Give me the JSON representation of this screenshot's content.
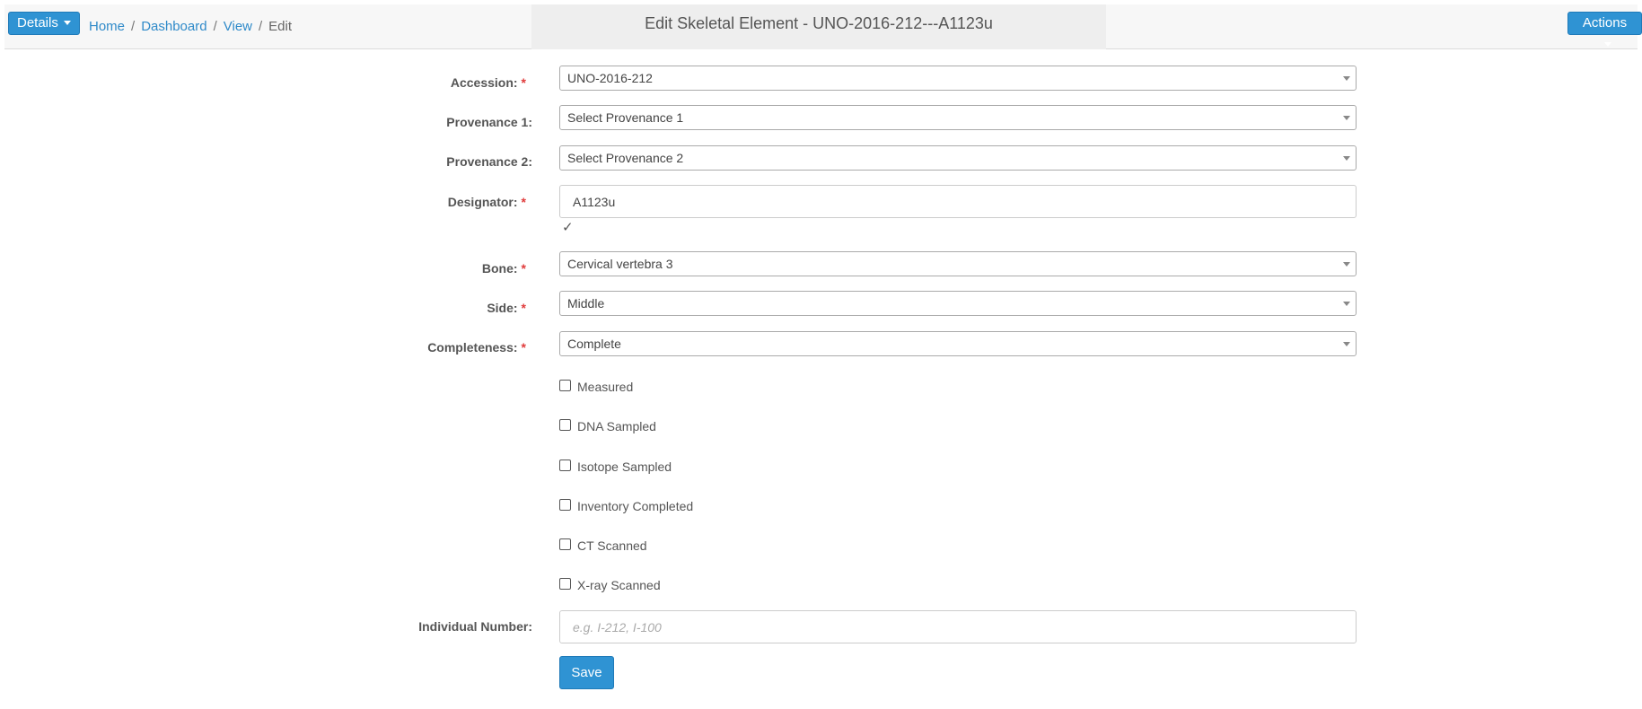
{
  "header": {
    "details_label": "Details",
    "actions_label": "Actions",
    "title": "Edit Skeletal Element - UNO-2016-212---A1123u",
    "breadcrumb": [
      "Home",
      "Dashboard",
      "View",
      "Edit"
    ],
    "breadcrumb_separator": "/"
  },
  "form": {
    "accession": {
      "label": "Accession:",
      "value": "UNO-2016-212",
      "required": true
    },
    "provenance1": {
      "label": "Provenance 1:",
      "value": "Select Provenance 1"
    },
    "provenance2": {
      "label": "Provenance 2:",
      "value": "Select Provenance 2"
    },
    "designator": {
      "label": "Designator:",
      "value": "A1123u",
      "required": true,
      "valid_mark": "✓"
    },
    "bone": {
      "label": "Bone:",
      "value": "Cervical vertebra 3",
      "required": true
    },
    "side": {
      "label": "Side:",
      "value": "Middle",
      "required": true
    },
    "completeness": {
      "label": "Completeness:",
      "value": "Complete",
      "required": true
    },
    "required_marker": "*",
    "checkboxes": [
      {
        "label": "Measured",
        "checked": false
      },
      {
        "label": "DNA Sampled",
        "checked": false
      },
      {
        "label": "Isotope Sampled",
        "checked": false
      },
      {
        "label": "Inventory Completed",
        "checked": false
      },
      {
        "label": "CT Scanned",
        "checked": false
      },
      {
        "label": "X-ray Scanned",
        "checked": false
      }
    ],
    "individual_number": {
      "label": "Individual Number:",
      "value": "",
      "placeholder": "e.g. I-212, I-100"
    },
    "save_label": "Save"
  },
  "colors": {
    "primary": "#2f93d3",
    "link": "#2f8ac9",
    "required": "#e03c3c",
    "topbar_bg": "#f7f7f7"
  }
}
